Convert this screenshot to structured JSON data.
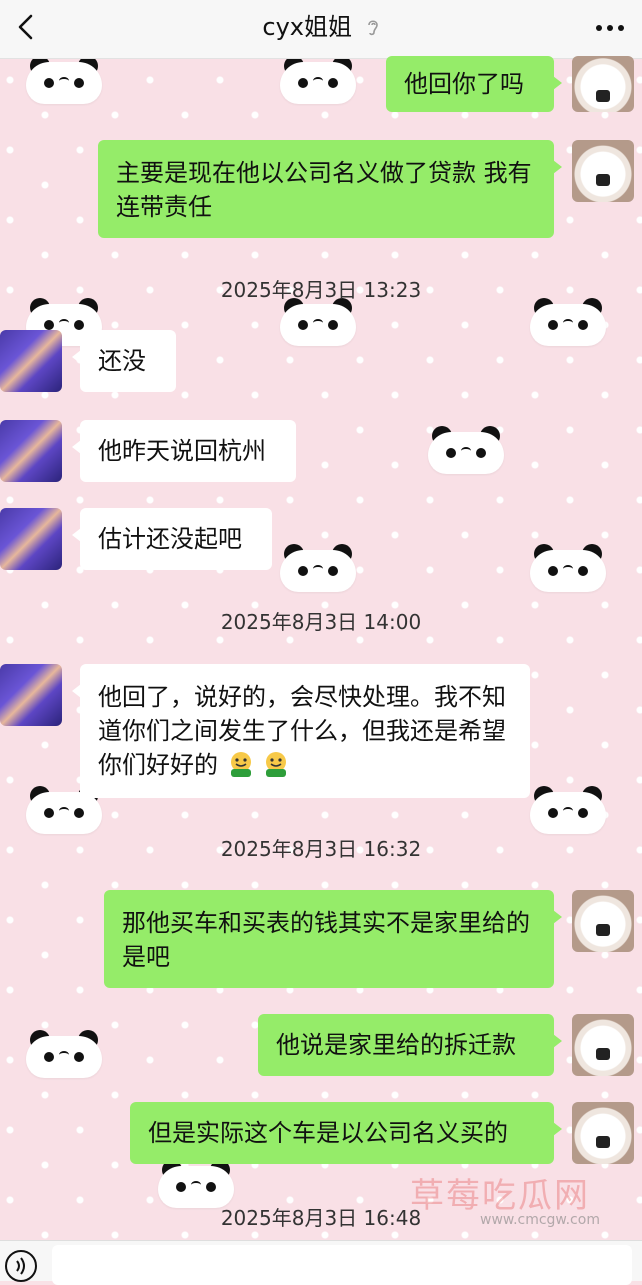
{
  "header": {
    "title": "cyx姐姐",
    "back_icon": "chevron-left-icon",
    "ear_icon": "ear-icon",
    "more_icon": "more-dots-icon"
  },
  "messages": [
    {
      "side": "right",
      "text": "他回你了吗"
    },
    {
      "side": "right",
      "text": "主要是现在他以公司名义做了贷款 我有连带责任"
    },
    {
      "side": "left",
      "text": "还没"
    },
    {
      "side": "left",
      "text": "他昨天说回杭州"
    },
    {
      "side": "left",
      "text": "估计还没起吧"
    },
    {
      "side": "left",
      "text": "他回了，说好的，会尽快处理。我不知道你们之间发生了什么，但我还是希望你们好好的",
      "emojis": [
        "hugging-face-icon",
        "hugging-face-icon"
      ]
    },
    {
      "side": "right",
      "text": "那他买车和买表的钱其实不是家里给的是吧"
    },
    {
      "side": "right",
      "text": "他说是家里给的拆迁款"
    },
    {
      "side": "right",
      "text": "但是实际这个车是以公司名义买的"
    }
  ],
  "timestamps": [
    "2025年8月3日 13:23",
    "2025年8月3日 14:00",
    "2025年8月3日 16:32",
    "2025年8月3日 16:48"
  ],
  "watermark": {
    "text": "草莓吃瓜网",
    "url": "www.cmcgw.com"
  },
  "input": {
    "voice_icon": "voice-icon"
  },
  "colors": {
    "my_bubble": "#95ec69",
    "friend_bubble": "#ffffff",
    "background": "#f9e0e6"
  }
}
